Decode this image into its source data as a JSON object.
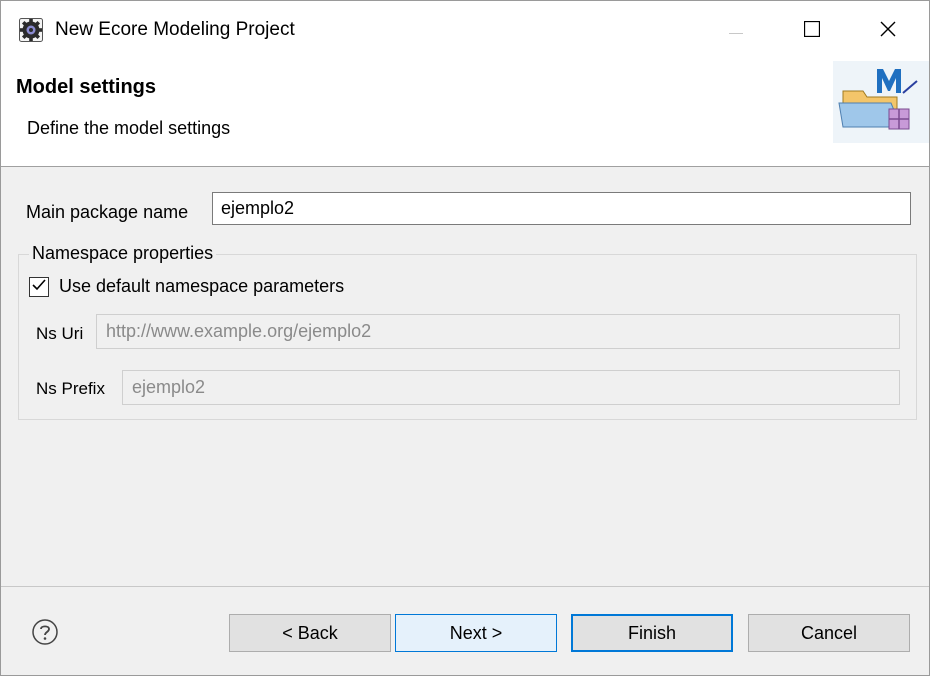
{
  "window": {
    "title": "New Ecore Modeling Project",
    "icons": {
      "app": "sirius-gear-icon",
      "minimize": "minimize-icon",
      "maximize": "maximize-icon",
      "close": "close-icon"
    }
  },
  "header": {
    "title": "Model settings",
    "description": "Define the model settings",
    "banner_icon": "ecore-modeling-project-wizard-icon"
  },
  "form": {
    "main_package_label": "Main package name",
    "main_package_value": "ejemplo2",
    "namespace_group_label": "Namespace properties",
    "use_default_label": "Use default namespace parameters",
    "use_default_checked": true,
    "ns_uri_label": "Ns Uri",
    "ns_uri_value": "http://www.example.org/ejemplo2",
    "ns_prefix_label": "Ns Prefix",
    "ns_prefix_value": "ejemplo2"
  },
  "footer": {
    "help_icon": "help-icon",
    "back_label": "< Back",
    "next_label": "Next >",
    "finish_label": "Finish",
    "cancel_label": "Cancel"
  },
  "colors": {
    "accent": "#0078d7",
    "next_bg": "#e5f1fb",
    "button_bg": "#e1e1e1",
    "disabled_text": "#8a8a8a"
  }
}
